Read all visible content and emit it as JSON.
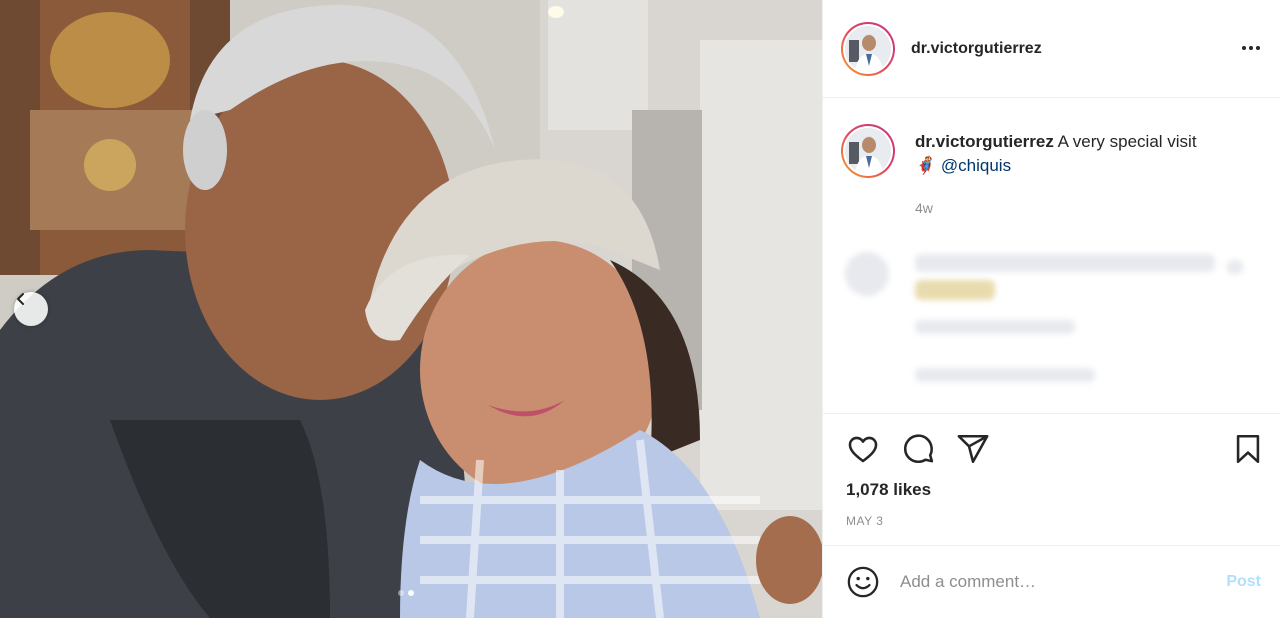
{
  "post": {
    "username": "dr.victorgutierrez",
    "caption_text": "A very special visit",
    "caption_emoji": "🦸",
    "mention": "@chiquis",
    "time_ago": "4w",
    "likes": "1,078 likes",
    "date": "MAY 3",
    "carousel": {
      "slide_count": 2,
      "active_slide": 2
    }
  },
  "comment_box": {
    "placeholder": "Add a comment…",
    "post_label": "Post"
  },
  "icons": {
    "more": "more-options-icon",
    "prev": "chevron-left-icon",
    "like": "heart-icon",
    "comment": "comment-bubble-icon",
    "share": "paper-plane-icon",
    "save": "bookmark-icon",
    "emoji": "smiley-icon"
  },
  "colors": {
    "text": "#262626",
    "secondary": "#8e8e8e",
    "mention": "#00376b",
    "post_disabled": "#b2dffc",
    "border": "#efefef"
  }
}
